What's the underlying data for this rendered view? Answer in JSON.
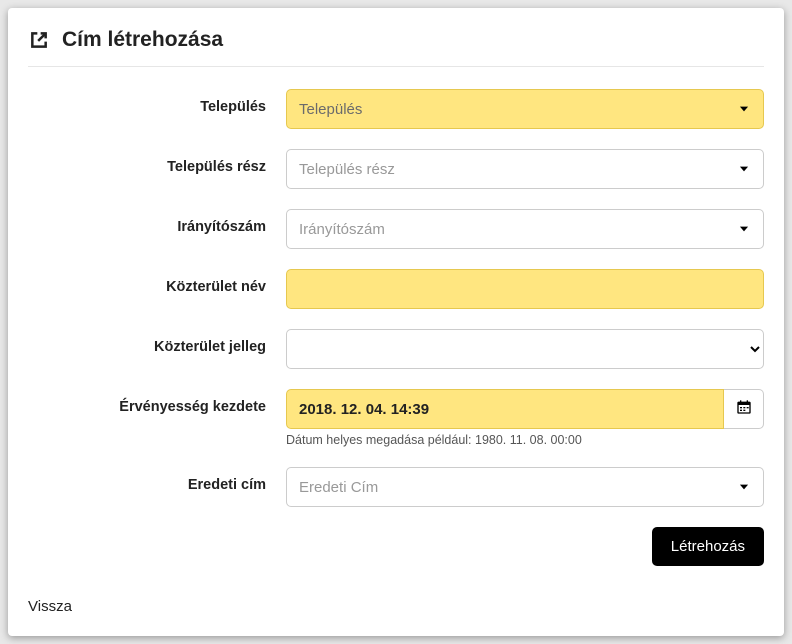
{
  "header": {
    "title": "Cím létrehozása"
  },
  "form": {
    "telepules": {
      "label": "Település",
      "placeholder": "Település"
    },
    "telepules_resz": {
      "label": "Település rész",
      "placeholder": "Település rész"
    },
    "iranyitoszam": {
      "label": "Irányítószám",
      "placeholder": "Irányítószám"
    },
    "kozterulet_nev": {
      "label": "Közterület név",
      "value": ""
    },
    "kozterulet_jelleg": {
      "label": "Közterület jelleg"
    },
    "ervenyesseg": {
      "label": "Érvényesség kezdete",
      "value": "2018. 12. 04. 14:39",
      "hint": "Dátum helyes megadása például: 1980. 11. 08. 00:00"
    },
    "eredeti_cim": {
      "label": "Eredeti cím",
      "placeholder": "Eredeti Cím"
    }
  },
  "buttons": {
    "submit": "Létrehozás",
    "back": "Vissza"
  }
}
